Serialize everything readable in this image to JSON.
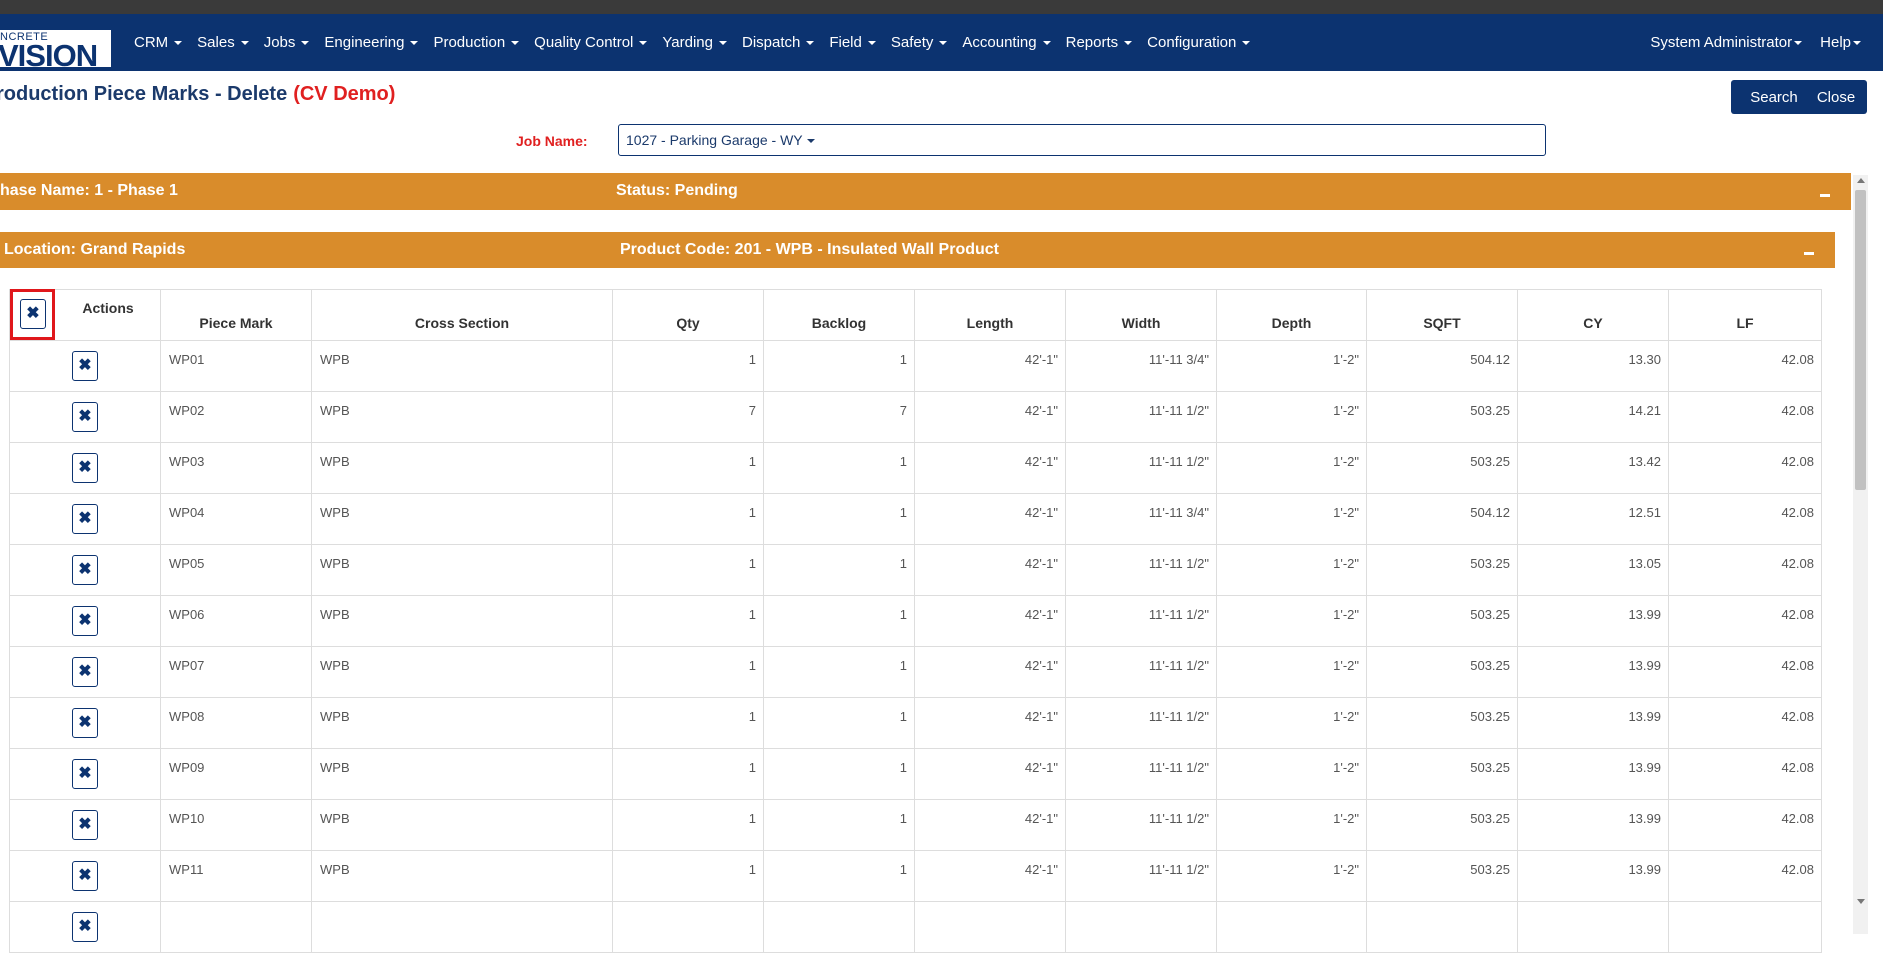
{
  "brand": {
    "top": "NCRETE",
    "main": "VISION"
  },
  "nav": {
    "items": [
      "CRM",
      "Sales",
      "Jobs",
      "Engineering",
      "Production",
      "Quality Control",
      "Yarding",
      "Dispatch",
      "Field",
      "Safety",
      "Accounting",
      "Reports",
      "Configuration"
    ],
    "user": "System Administrator",
    "help": "Help"
  },
  "page": {
    "title": "roduction Piece Marks - Delete",
    "demo_tag": "(CV Demo)"
  },
  "buttons": {
    "search": "Search",
    "close": "Close"
  },
  "job": {
    "label": "Job Name:",
    "value": "1027 - Parking Garage - WY"
  },
  "phase": {
    "name": "hase Name: 1 - Phase 1",
    "status": "Status: Pending"
  },
  "location": {
    "name": "Location: Grand Rapids",
    "product": "Product Code: 201 - WPB - Insulated Wall Product"
  },
  "table": {
    "actions_header": "Actions",
    "columns": [
      "Piece Mark",
      "Cross Section",
      "Qty",
      "Backlog",
      "Length",
      "Width",
      "Depth",
      "SQFT",
      "CY",
      "LF"
    ],
    "delete_icon": "✖",
    "rows": [
      [
        "WP01",
        "WPB",
        "1",
        "1",
        "42'-1\"",
        "11'-11 3/4\"",
        "1'-2\"",
        "504.12",
        "13.30",
        "42.08"
      ],
      [
        "WP02",
        "WPB",
        "7",
        "7",
        "42'-1\"",
        "11'-11 1/2\"",
        "1'-2\"",
        "503.25",
        "14.21",
        "42.08"
      ],
      [
        "WP03",
        "WPB",
        "1",
        "1",
        "42'-1\"",
        "11'-11 1/2\"",
        "1'-2\"",
        "503.25",
        "13.42",
        "42.08"
      ],
      [
        "WP04",
        "WPB",
        "1",
        "1",
        "42'-1\"",
        "11'-11 3/4\"",
        "1'-2\"",
        "504.12",
        "12.51",
        "42.08"
      ],
      [
        "WP05",
        "WPB",
        "1",
        "1",
        "42'-1\"",
        "11'-11 1/2\"",
        "1'-2\"",
        "503.25",
        "13.05",
        "42.08"
      ],
      [
        "WP06",
        "WPB",
        "1",
        "1",
        "42'-1\"",
        "11'-11 1/2\"",
        "1'-2\"",
        "503.25",
        "13.99",
        "42.08"
      ],
      [
        "WP07",
        "WPB",
        "1",
        "1",
        "42'-1\"",
        "11'-11 1/2\"",
        "1'-2\"",
        "503.25",
        "13.99",
        "42.08"
      ],
      [
        "WP08",
        "WPB",
        "1",
        "1",
        "42'-1\"",
        "11'-11 1/2\"",
        "1'-2\"",
        "503.25",
        "13.99",
        "42.08"
      ],
      [
        "WP09",
        "WPB",
        "1",
        "1",
        "42'-1\"",
        "11'-11 1/2\"",
        "1'-2\"",
        "503.25",
        "13.99",
        "42.08"
      ],
      [
        "WP10",
        "WPB",
        "1",
        "1",
        "42'-1\"",
        "11'-11 1/2\"",
        "1'-2\"",
        "503.25",
        "13.99",
        "42.08"
      ],
      [
        "WP11",
        "WPB",
        "1",
        "1",
        "42'-1\"",
        "11'-11 1/2\"",
        "1'-2\"",
        "503.25",
        "13.99",
        "42.08"
      ],
      [
        "",
        "",
        "",
        "",
        "",
        "",
        "",
        "",
        "",
        ""
      ]
    ]
  },
  "colors": {
    "navbar": "#0c3370",
    "accent_bar": "#d98c2b",
    "alert_red": "#e02020",
    "highlight": "#e0171b"
  }
}
